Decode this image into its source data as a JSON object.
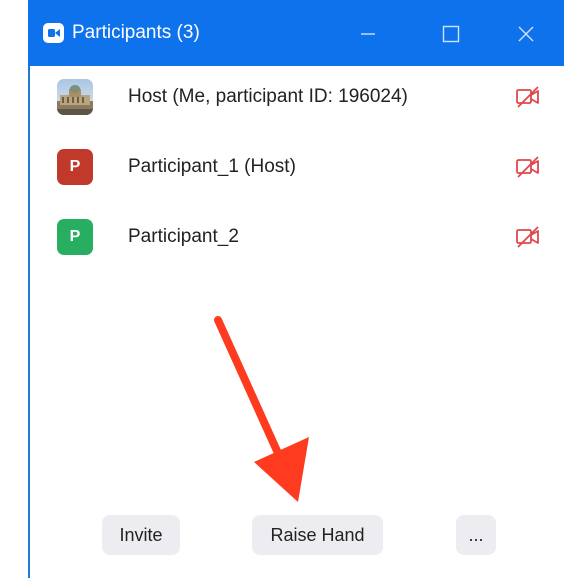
{
  "window": {
    "title": "Participants (3)",
    "controls": {
      "minimize": "—",
      "maximize": "☐",
      "close": "✕"
    }
  },
  "participants": [
    {
      "name": "Host (Me, participant ID: 196024)",
      "avatar_type": "photo",
      "mic_icon": "mic-muted-icon"
    },
    {
      "name": "Participant_1 (Host)",
      "avatar_letter": "P",
      "avatar_color": "#c0392b",
      "mic_icon": "mic-muted-icon"
    },
    {
      "name": "Participant_2",
      "avatar_letter": "P",
      "avatar_color": "#27ae60",
      "mic_icon": "mic-muted-icon"
    }
  ],
  "footer": {
    "invite_label": "Invite",
    "raise_hand_label": "Raise Hand",
    "more_label": "..."
  },
  "colors": {
    "titlebar": "#0e72ed",
    "muted_red": "#e0474c",
    "annotation_arrow": "#ff3b1f"
  }
}
